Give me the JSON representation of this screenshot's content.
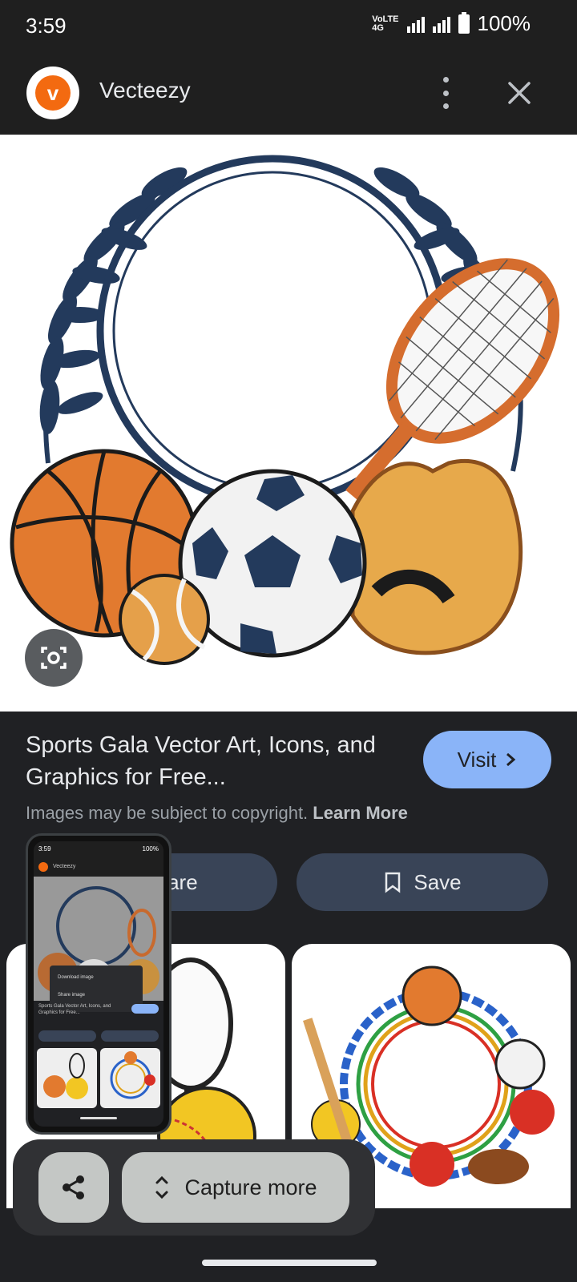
{
  "status": {
    "time": "3:59",
    "network_label": "VoLTE2 4G",
    "battery": "100%"
  },
  "header": {
    "site_name": "Vecteezy",
    "logo_letter": "v"
  },
  "result": {
    "title": "Sports Gala Vector Art, Icons, and Graphics for Free...",
    "visit_label": "Visit",
    "copyright_text": "Images may be subject to copyright.",
    "learn_more": "Learn More",
    "share_label": "Share",
    "save_label": "Save"
  },
  "thumbnail": {
    "time": "3:59",
    "battery": "100%",
    "site_name": "Vecteezy",
    "menu_items": [
      "Download image",
      "Share image"
    ]
  },
  "capture_bar": {
    "capture_more_label": "Capture more"
  },
  "colors": {
    "accent_visit": "#8ab4f8",
    "button_bg": "#394457",
    "laurel": "#233a5c",
    "brand_orange": "#f36a10"
  }
}
